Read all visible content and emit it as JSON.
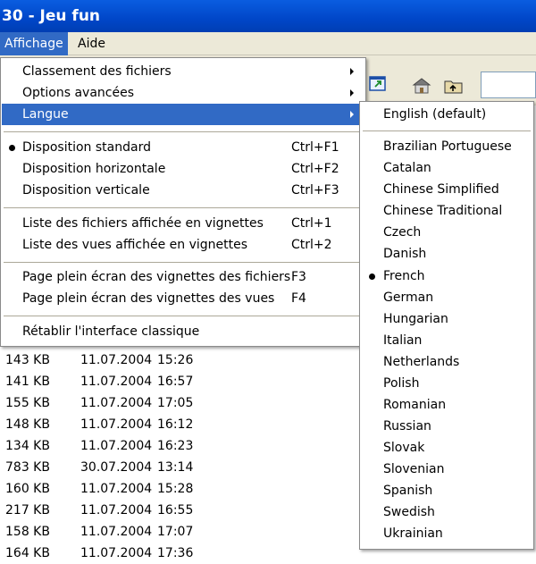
{
  "window": {
    "title": "30 - Jeu fun"
  },
  "menubar": [
    {
      "label": "Affichage",
      "active": true
    },
    {
      "label": "Aide",
      "active": false
    }
  ],
  "affichage_menu": {
    "items": [
      {
        "label": "Classement des fichiers",
        "shortcut": "",
        "submenu": true
      },
      {
        "label": "Options avancées",
        "shortcut": "",
        "submenu": true
      },
      {
        "label": "Langue",
        "shortcut": "",
        "submenu": true,
        "highlighted": true
      },
      {
        "label": "Disposition standard",
        "shortcut": "Ctrl+F1",
        "checked": true
      },
      {
        "label": "Disposition horizontale",
        "shortcut": "Ctrl+F2"
      },
      {
        "label": "Disposition verticale",
        "shortcut": "Ctrl+F3"
      },
      {
        "label": "Liste des fichiers affichée en vignettes",
        "shortcut": "Ctrl+1"
      },
      {
        "label": "Liste des vues affichée en vignettes",
        "shortcut": "Ctrl+2"
      },
      {
        "label": "Page plein écran des vignettes des fichiers",
        "shortcut": "F3"
      },
      {
        "label": "Page plein écran des vignettes des vues",
        "shortcut": "F4"
      },
      {
        "label": "Rétablir l'interface classique",
        "shortcut": ""
      }
    ]
  },
  "langue_menu": {
    "items": [
      {
        "label": "English (default)"
      },
      {
        "label": "Brazilian Portuguese"
      },
      {
        "label": "Catalan"
      },
      {
        "label": "Chinese Simplified"
      },
      {
        "label": "Chinese Traditional"
      },
      {
        "label": "Czech"
      },
      {
        "label": "Danish"
      },
      {
        "label": "French",
        "checked": true
      },
      {
        "label": "German"
      },
      {
        "label": "Hungarian"
      },
      {
        "label": "Italian"
      },
      {
        "label": "Netherlands"
      },
      {
        "label": "Polish"
      },
      {
        "label": "Romanian"
      },
      {
        "label": "Russian"
      },
      {
        "label": "Slovak"
      },
      {
        "label": "Slovenian"
      },
      {
        "label": "Spanish"
      },
      {
        "label": "Swedish"
      },
      {
        "label": "Ukrainian"
      }
    ]
  },
  "file_rows": [
    {
      "size": "143 KB",
      "date": "11.07.2004",
      "time": "15:26"
    },
    {
      "size": "141 KB",
      "date": "11.07.2004",
      "time": "16:57"
    },
    {
      "size": "155 KB",
      "date": "11.07.2004",
      "time": "17:05"
    },
    {
      "size": "148 KB",
      "date": "11.07.2004",
      "time": "16:12"
    },
    {
      "size": "134 KB",
      "date": "11.07.2004",
      "time": "16:23"
    },
    {
      "size": "783 KB",
      "date": "30.07.2004",
      "time": "13:14"
    },
    {
      "size": "160 KB",
      "date": "11.07.2004",
      "time": "15:28"
    },
    {
      "size": "217 KB",
      "date": "11.07.2004",
      "time": "16:55"
    },
    {
      "size": "158 KB",
      "date": "11.07.2004",
      "time": "17:07"
    },
    {
      "size": "164 KB",
      "date": "11.07.2004",
      "time": "17:36"
    }
  ],
  "toolbar_icons": [
    "resize-icon",
    "home-folder-icon",
    "up-folder-icon"
  ]
}
